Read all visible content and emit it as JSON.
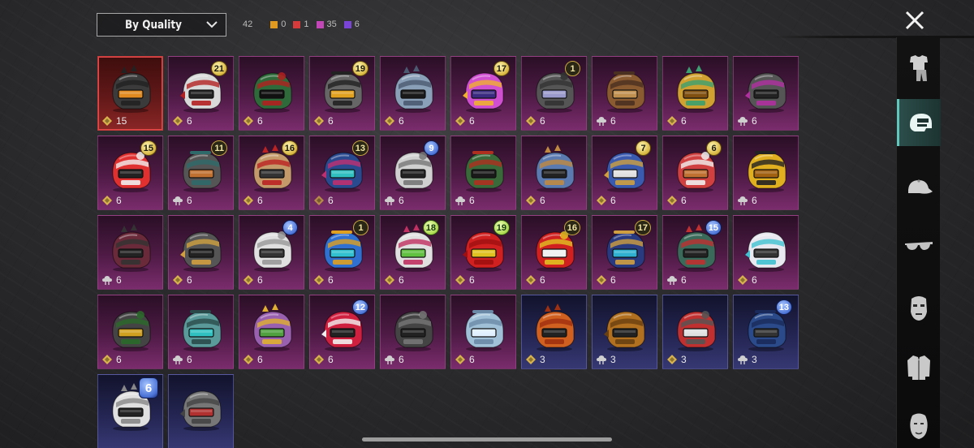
{
  "sort": {
    "label": "By Quality"
  },
  "counts": {
    "total": "42",
    "items": [
      {
        "color": "#e09a1f",
        "value": "0"
      },
      {
        "color": "#d63a3a",
        "value": "1"
      },
      {
        "color": "#c447b8",
        "value": "35"
      },
      {
        "color": "#7a45d6",
        "value": "6"
      }
    ]
  },
  "sidebar": {
    "categories": [
      {
        "name": "outfit-icon",
        "active": false
      },
      {
        "name": "helmet-icon",
        "active": true
      },
      {
        "name": "cap-icon",
        "active": false
      },
      {
        "name": "glasses-icon",
        "active": false
      },
      {
        "name": "mask-icon",
        "active": false
      },
      {
        "name": "jacket-icon",
        "active": false
      },
      {
        "name": "face-icon",
        "active": false
      }
    ]
  },
  "items": [
    {
      "tier": "red",
      "qty": "15",
      "qtyIcon": "gold",
      "badge": "",
      "badgeStyle": "",
      "colors": [
        "#3b3b3b",
        "#222",
        "#e08a20"
      ]
    },
    {
      "tier": "purple",
      "qty": "6",
      "qtyIcon": "gold",
      "badge": "21",
      "badgeStyle": "gold",
      "colors": [
        "#d9d9d9",
        "#b32020",
        "#222"
      ]
    },
    {
      "tier": "purple",
      "qty": "6",
      "qtyIcon": "gold",
      "badge": "",
      "badgeStyle": "",
      "colors": [
        "#2f6b3a",
        "#b32020",
        "#111"
      ]
    },
    {
      "tier": "purple",
      "qty": "6",
      "qtyIcon": "gold",
      "badge": "19",
      "badgeStyle": "gold",
      "colors": [
        "#666",
        "#222",
        "#e0a020"
      ]
    },
    {
      "tier": "purple",
      "qty": "6",
      "qtyIcon": "gold",
      "badge": "",
      "badgeStyle": "",
      "colors": [
        "#8aa0b8",
        "#4a5a70",
        "#1a1a1a"
      ]
    },
    {
      "tier": "purple",
      "qty": "6",
      "qtyIcon": "gold",
      "badge": "17",
      "badgeStyle": "gold",
      "colors": [
        "#d04fd0",
        "#f0b030",
        "#3a2a80"
      ]
    },
    {
      "tier": "purple",
      "qty": "6",
      "qtyIcon": "gold",
      "badge": "1",
      "badgeStyle": "dark",
      "colors": [
        "#555",
        "#333",
        "#9a9acc"
      ]
    },
    {
      "tier": "purple",
      "qty": "6",
      "qtyIcon": "silver",
      "badge": "",
      "badgeStyle": "",
      "colors": [
        "#8a5a30",
        "#4a3020",
        "#c09050"
      ]
    },
    {
      "tier": "purple",
      "qty": "6",
      "qtyIcon": "gold",
      "badge": "",
      "badgeStyle": "",
      "colors": [
        "#d0a030",
        "#3aa070",
        "#805010"
      ]
    },
    {
      "tier": "purple",
      "qty": "6",
      "qtyIcon": "silver",
      "badge": "",
      "badgeStyle": "",
      "colors": [
        "#555",
        "#b030a0",
        "#222"
      ]
    },
    {
      "tier": "purple",
      "qty": "6",
      "qtyIcon": "gold",
      "badge": "15",
      "badgeStyle": "gold",
      "colors": [
        "#e03030",
        "#f0f0f0",
        "#222"
      ]
    },
    {
      "tier": "purple",
      "qty": "6",
      "qtyIcon": "silver",
      "badge": "11",
      "badgeStyle": "dark",
      "colors": [
        "#555",
        "#2f6a6a",
        "#c07030"
      ]
    },
    {
      "tier": "purple",
      "qty": "6",
      "qtyIcon": "gold",
      "badge": "16",
      "badgeStyle": "gold",
      "colors": [
        "#c49a6a",
        "#b22",
        "#333"
      ]
    },
    {
      "tier": "purple",
      "qty": "6",
      "qtyIcon": "bronze",
      "badge": "13",
      "badgeStyle": "dark",
      "colors": [
        "#2a4a90",
        "#c03070",
        "#30c0c0"
      ]
    },
    {
      "tier": "purple",
      "qty": "6",
      "qtyIcon": "silver",
      "badge": "9",
      "badgeStyle": "blue",
      "colors": [
        "#d0d0d0",
        "#777",
        "#222"
      ]
    },
    {
      "tier": "purple",
      "qty": "6",
      "qtyIcon": "silver",
      "badge": "",
      "badgeStyle": "",
      "colors": [
        "#3a6a3a",
        "#b03020",
        "#1a1a1a"
      ]
    },
    {
      "tier": "purple",
      "qty": "6",
      "qtyIcon": "gold",
      "badge": "",
      "badgeStyle": "",
      "colors": [
        "#5a7ab0",
        "#c08a40",
        "#222"
      ]
    },
    {
      "tier": "purple",
      "qty": "6",
      "qtyIcon": "gold",
      "badge": "7",
      "badgeStyle": "gold",
      "colors": [
        "#3a5ab0",
        "#d0a040",
        "#e0e0e0"
      ]
    },
    {
      "tier": "purple",
      "qty": "6",
      "qtyIcon": "gold",
      "badge": "6",
      "badgeStyle": "gold",
      "colors": [
        "#d04040",
        "#f0f0f0",
        "#c07030"
      ]
    },
    {
      "tier": "purple",
      "qty": "6",
      "qtyIcon": "silver",
      "badge": "",
      "badgeStyle": "",
      "colors": [
        "#e0b020",
        "#222",
        "#a06010"
      ]
    },
    {
      "tier": "purple",
      "qty": "6",
      "qtyIcon": "silver",
      "badge": "",
      "badgeStyle": "",
      "colors": [
        "#6a2a3a",
        "#333",
        "#222"
      ]
    },
    {
      "tier": "purple",
      "qty": "6",
      "qtyIcon": "gold",
      "badge": "",
      "badgeStyle": "",
      "colors": [
        "#555",
        "#d0a040",
        "#222"
      ]
    },
    {
      "tier": "purple",
      "qty": "6",
      "qtyIcon": "gold",
      "badge": "4",
      "badgeStyle": "blue",
      "colors": [
        "#e0e0e0",
        "#999",
        "#333"
      ]
    },
    {
      "tier": "purple",
      "qty": "6",
      "qtyIcon": "gold",
      "badge": "1",
      "badgeStyle": "dark",
      "colors": [
        "#3070d0",
        "#e0a020",
        "#30c0d0"
      ]
    },
    {
      "tier": "purple",
      "qty": "6",
      "qtyIcon": "gold",
      "badge": "18",
      "badgeStyle": "green",
      "colors": [
        "#e0e0e0",
        "#c03060",
        "#60c040"
      ]
    },
    {
      "tier": "purple",
      "qty": "6",
      "qtyIcon": "gold",
      "badge": "19",
      "badgeStyle": "green",
      "colors": [
        "#d02020",
        "#a01010",
        "#e0c020"
      ]
    },
    {
      "tier": "purple",
      "qty": "6",
      "qtyIcon": "gold",
      "badge": "16",
      "badgeStyle": "dark",
      "colors": [
        "#d02020",
        "#e0c020",
        "#f0f0f0"
      ]
    },
    {
      "tier": "purple",
      "qty": "6",
      "qtyIcon": "gold",
      "badge": "17",
      "badgeStyle": "dark",
      "colors": [
        "#2a3a80",
        "#d0a040",
        "#30b0d0"
      ]
    },
    {
      "tier": "purple",
      "qty": "6",
      "qtyIcon": "silver",
      "badge": "15",
      "badgeStyle": "blue",
      "colors": [
        "#3a6a5a",
        "#c03030",
        "#222"
      ]
    },
    {
      "tier": "purple",
      "qty": "6",
      "qtyIcon": "gold",
      "badge": "",
      "badgeStyle": "",
      "colors": [
        "#e8e8f0",
        "#40c0d0",
        "#333"
      ]
    },
    {
      "tier": "purple",
      "qty": "6",
      "qtyIcon": "gold",
      "badge": "",
      "badgeStyle": "",
      "colors": [
        "#444",
        "#2a6a2a",
        "#d0a020"
      ]
    },
    {
      "tier": "purple",
      "qty": "6",
      "qtyIcon": "silver",
      "badge": "",
      "badgeStyle": "",
      "colors": [
        "#5a9a9a",
        "#2a4a4a",
        "#30c0c0"
      ]
    },
    {
      "tier": "purple",
      "qty": "6",
      "qtyIcon": "gold",
      "badge": "",
      "badgeStyle": "",
      "colors": [
        "#9a60b0",
        "#e0b030",
        "#50a040"
      ]
    },
    {
      "tier": "purple",
      "qty": "6",
      "qtyIcon": "gold",
      "badge": "12",
      "badgeStyle": "blue",
      "colors": [
        "#d02040",
        "#f0f0f0",
        "#222"
      ]
    },
    {
      "tier": "purple",
      "qty": "6",
      "qtyIcon": "silver",
      "badge": "",
      "badgeStyle": "",
      "colors": [
        "#444",
        "#777",
        "#222"
      ]
    },
    {
      "tier": "purple",
      "qty": "6",
      "qtyIcon": "gold",
      "badge": "",
      "badgeStyle": "",
      "colors": [
        "#a0c0d8",
        "#6a8aa8",
        "#e0f0ff"
      ]
    },
    {
      "tier": "blue",
      "qty": "3",
      "qtyIcon": "gold",
      "badge": "",
      "badgeStyle": "",
      "colors": [
        "#d06020",
        "#a03010",
        "#222"
      ]
    },
    {
      "tier": "blue",
      "qty": "3",
      "qtyIcon": "silver",
      "badge": "",
      "badgeStyle": "",
      "colors": [
        "#b07020",
        "#6a4010",
        "#222"
      ]
    },
    {
      "tier": "blue",
      "qty": "3",
      "qtyIcon": "gold",
      "badge": "",
      "badgeStyle": "",
      "colors": [
        "#c03030",
        "#555",
        "#e0e0e0"
      ]
    },
    {
      "tier": "blue",
      "qty": "3",
      "qtyIcon": "silver",
      "badge": "13",
      "badgeStyle": "blue",
      "colors": [
        "#2a4a8a",
        "#1a2a5a",
        "#333"
      ]
    },
    {
      "tier": "blue",
      "qty": "",
      "qtyIcon": "",
      "badge": "6",
      "badgeStyle": "blue big",
      "colors": [
        "#e0e0e0",
        "#888",
        "#222"
      ]
    },
    {
      "tier": "blue",
      "qty": "",
      "qtyIcon": "",
      "badge": "",
      "badgeStyle": "",
      "colors": [
        "#777",
        "#444",
        "#b03030"
      ]
    }
  ]
}
